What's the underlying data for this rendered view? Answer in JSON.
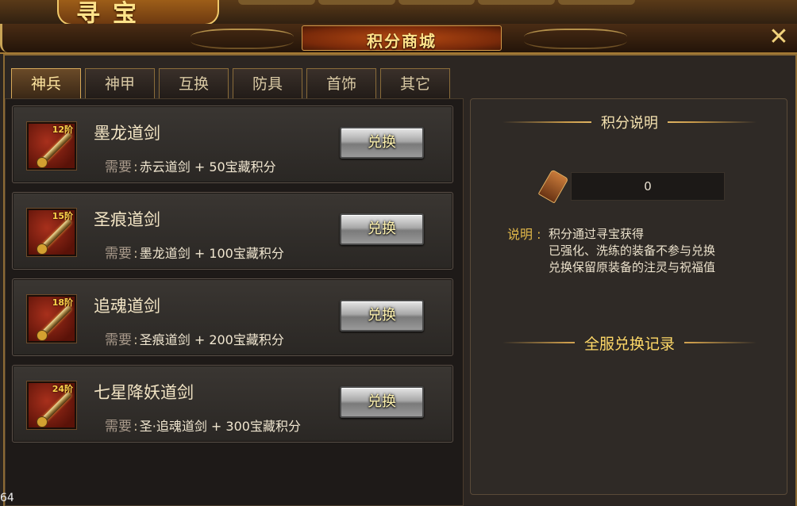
{
  "header": {
    "window_title": "寻宝",
    "panel_title": "积分商城",
    "close_label": "✕"
  },
  "tabs": [
    {
      "label": "神兵",
      "active": true
    },
    {
      "label": "神甲",
      "active": false
    },
    {
      "label": "互换",
      "active": false
    },
    {
      "label": "防具",
      "active": false
    },
    {
      "label": "首饰",
      "active": false
    },
    {
      "label": "其它",
      "active": false
    }
  ],
  "items": [
    {
      "level": "12阶",
      "name": "墨龙道剑",
      "req_label": "需要",
      "req_text": "赤云道剑 + 50宝藏积分",
      "button": "兑换"
    },
    {
      "level": "15阶",
      "name": "圣痕道剑",
      "req_label": "需要",
      "req_text": "墨龙道剑 + 100宝藏积分",
      "button": "兑换"
    },
    {
      "level": "18阶",
      "name": "追魂道剑",
      "req_label": "需要",
      "req_text": "圣痕道剑 + 200宝藏积分",
      "button": "兑换"
    },
    {
      "level": "24阶",
      "name": "七星降妖道剑",
      "req_label": "需要",
      "req_text": "圣·追魂道剑 + 300宝藏积分",
      "button": "兑换"
    }
  ],
  "points": {
    "section_title": "积分说明",
    "value": "0",
    "desc_label": "说明",
    "desc_lines": [
      "积分通过寻宝获得",
      "已强化、洗练的装备不参与兑换",
      "兑换保留原装备的注灵与祝福值"
    ],
    "record_title": "全服兑换记录"
  },
  "footer": {
    "corner_text": "64"
  }
}
